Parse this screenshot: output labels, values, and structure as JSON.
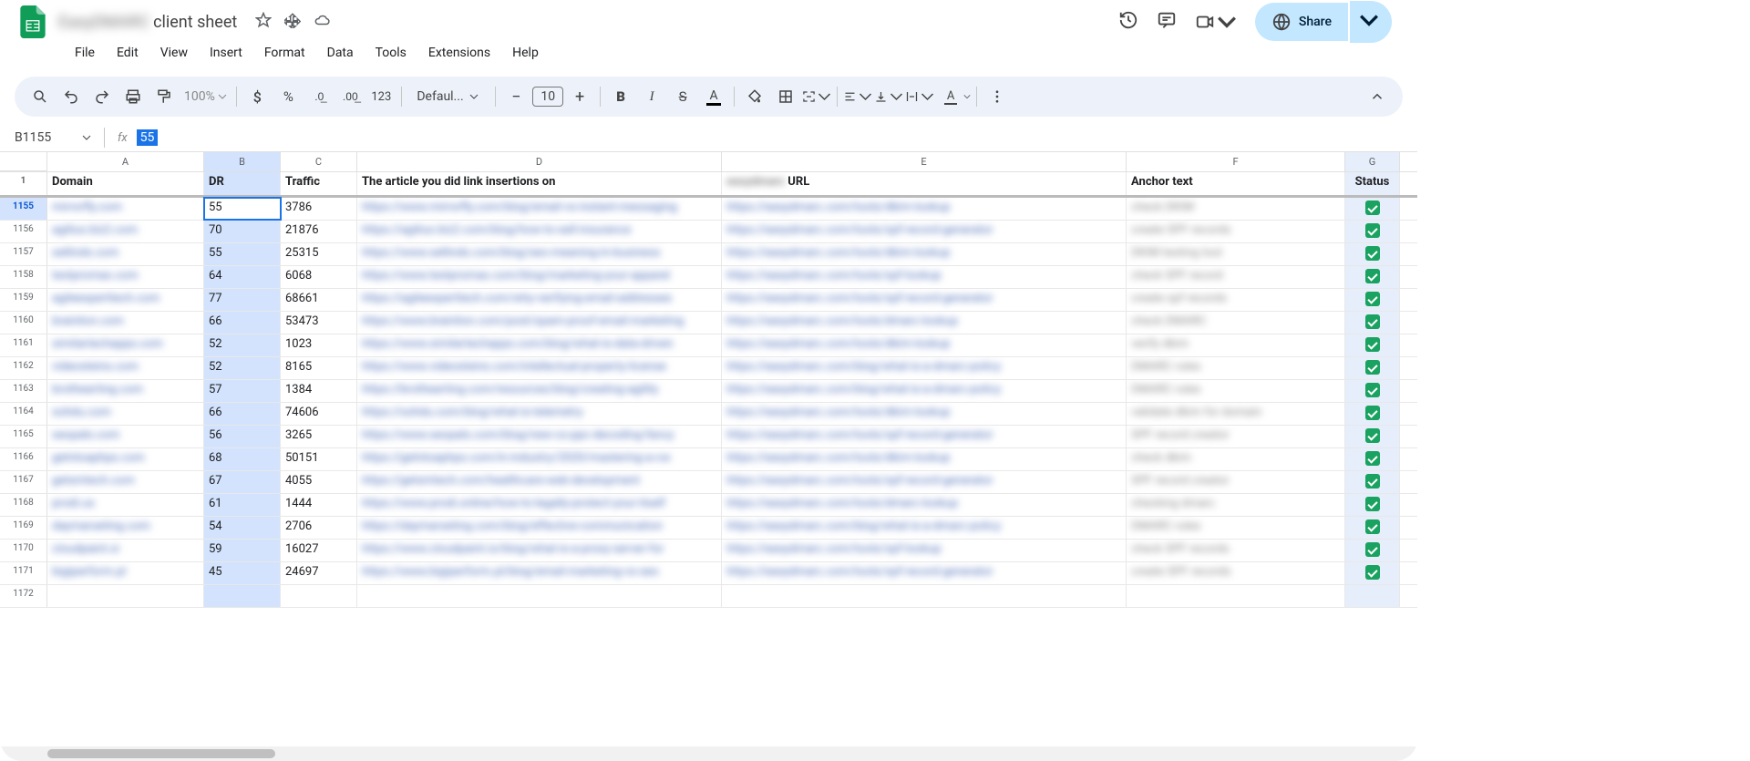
{
  "doc": {
    "title_blurred": "EasyDMARC",
    "title": "client sheet"
  },
  "menu": [
    "File",
    "Edit",
    "View",
    "Insert",
    "Format",
    "Data",
    "Tools",
    "Extensions",
    "Help"
  ],
  "toolbar": {
    "zoom": "100%",
    "font": "Defaul...",
    "fontsize": "10"
  },
  "formula": {
    "ref": "B1155",
    "value": "55"
  },
  "share": "Share",
  "cols": [
    "A",
    "B",
    "C",
    "D",
    "E",
    "F",
    "G"
  ],
  "header_row": {
    "num": "1",
    "A": "Domain",
    "B": "DR",
    "C": "Traffic",
    "D": "The article you did link insertions on",
    "E_blur": "easydmarc",
    "E": "URL",
    "F": "Anchor text",
    "G": "Status"
  },
  "rows": [
    {
      "num": "1155",
      "A": "mirrorfly.com",
      "B": "55",
      "C": "3786",
      "D": "https://www.mirrorfly.com/blog/email-vs-instant-messaging",
      "E": "https://easydmarc.com/tools/dkim-lookup",
      "F": "check DKIM",
      "ok": true,
      "active": true
    },
    {
      "num": "1156",
      "A": "agiliux.biz2.com",
      "B": "70",
      "C": "21876",
      "D": "https://agiliux.biz2.com/blog/how-to-sell-insurance",
      "E": "https://easydmarc.com/tools/spf-record-generator",
      "F": "create SPF records",
      "ok": true
    },
    {
      "num": "1157",
      "A": "sellinds.com",
      "B": "55",
      "C": "25315",
      "D": "https://www.sellinds.com/blog/seo-meaning-in-business",
      "E": "https://easydmarc.com/tools/dkim-lookup",
      "F": "DKIM testing tool",
      "ok": true
    },
    {
      "num": "1158",
      "A": "textpromax.com",
      "B": "64",
      "C": "6068",
      "D": "https://www.textpromax.com/blog/marketing-your-apparel",
      "E": "https://easydmarc.com/tools/spf-lookup",
      "F": "check SPF record",
      "ok": true
    },
    {
      "num": "1159",
      "A": "agileexperttech.com",
      "B": "77",
      "C": "68661",
      "D": "https://agileexperttech.com/why-verifying-email-addresses",
      "E": "https://easydmarc.com/tools/spf-record-generator",
      "F": "create spf records",
      "ok": true
    },
    {
      "num": "1160",
      "A": "brainlion.com",
      "B": "66",
      "C": "53473",
      "D": "https://www.brainlion.com/post/spam-proof-email-marketing",
      "E": "https://easydmarc.com/tools/dmarc-lookup",
      "F": "check DMARC",
      "ok": true
    },
    {
      "num": "1161",
      "A": "similartechapps.com",
      "B": "52",
      "C": "1023",
      "D": "https://www.similartechapps.com/blog/what-is-data-driven",
      "E": "https://easydmarc.com/tools/dkim-lookup",
      "F": "verify dkim",
      "ok": true
    },
    {
      "num": "1162",
      "A": "videosteins.com",
      "B": "52",
      "C": "8165",
      "D": "https://www.videosteins.com/intellectual-property-license",
      "E": "https://easydmarc.com/blog/what-is-a-dmarc-policy",
      "F": "DMARC rules",
      "ok": true
    },
    {
      "num": "1163",
      "A": "brothearting.com",
      "B": "57",
      "C": "1384",
      "D": "https://brothearting.com/resources/blog/creating-agility",
      "E": "https://easydmarc.com/blog/what-is-a-dmarc-policy",
      "F": "DMARC rules",
      "ok": true
    },
    {
      "num": "1164",
      "A": "sohdu.com",
      "B": "66",
      "C": "74606",
      "D": "https://sohdu.com/blog/what-is-telemetry",
      "E": "https://easydmarc.com/tools/dkim-lookup",
      "F": "validate dkim for domain",
      "ok": true
    },
    {
      "num": "1165",
      "A": "seopals.com",
      "B": "56",
      "C": "3265",
      "D": "https://www.seopals.com/blog/new-cs-ppc-decoding-fancy",
      "E": "https://easydmarc.com/tools/spf-record-generator",
      "F": "SPF record creator",
      "ok": true
    },
    {
      "num": "1166",
      "A": "getntoaphps.com",
      "B": "68",
      "C": "50151",
      "D": "https://getntoaphps.com/in-industry/2020/mastering-a-cw",
      "E": "https://easydmarc.com/tools/dkim-lookup",
      "F": "check dkim",
      "ok": true
    },
    {
      "num": "1167",
      "A": "getsmtech.com",
      "B": "67",
      "C": "4055",
      "D": "https://getsmtech.com/healthcare-web-development",
      "E": "https://easydmarc.com/tools/spf-record-generator",
      "F": "SPF record creator",
      "ok": true
    },
    {
      "num": "1168",
      "A": "prodi.us",
      "B": "61",
      "C": "1444",
      "D": "https://www.prodi.online/how-to-legally-protect-your-itself",
      "E": "https://easydmarc.com/tools/dmarc-lookup",
      "F": "checking dmarc",
      "ok": true
    },
    {
      "num": "1169",
      "A": "daymarseting.com",
      "B": "54",
      "C": "2706",
      "D": "https://daymarseting.com/blog/effective-communication",
      "E": "https://easydmarc.com/blog/what-is-a-dmarc-policy",
      "F": "DMARC rules",
      "ok": true
    },
    {
      "num": "1170",
      "A": "cloudpaint.xi",
      "B": "59",
      "C": "16027",
      "D": "https://www.cloudpaint.io/blog/what-is-a-proxy-server-for",
      "E": "https://easydmarc.com/tools/spf-lookup",
      "F": "check SPF records",
      "ok": true
    },
    {
      "num": "1171",
      "A": "bigiperform.pl",
      "B": "45",
      "C": "24697",
      "D": "https://www.bigiperform.pl/blog/email-marketing-vs-seo",
      "E": "https://easydmarc.com/tools/spf-record-generator",
      "F": "create SPF records",
      "ok": true
    },
    {
      "num": "1172",
      "A": "",
      "B": "",
      "C": "",
      "D": "",
      "E": "",
      "F": "",
      "ok": false
    }
  ]
}
